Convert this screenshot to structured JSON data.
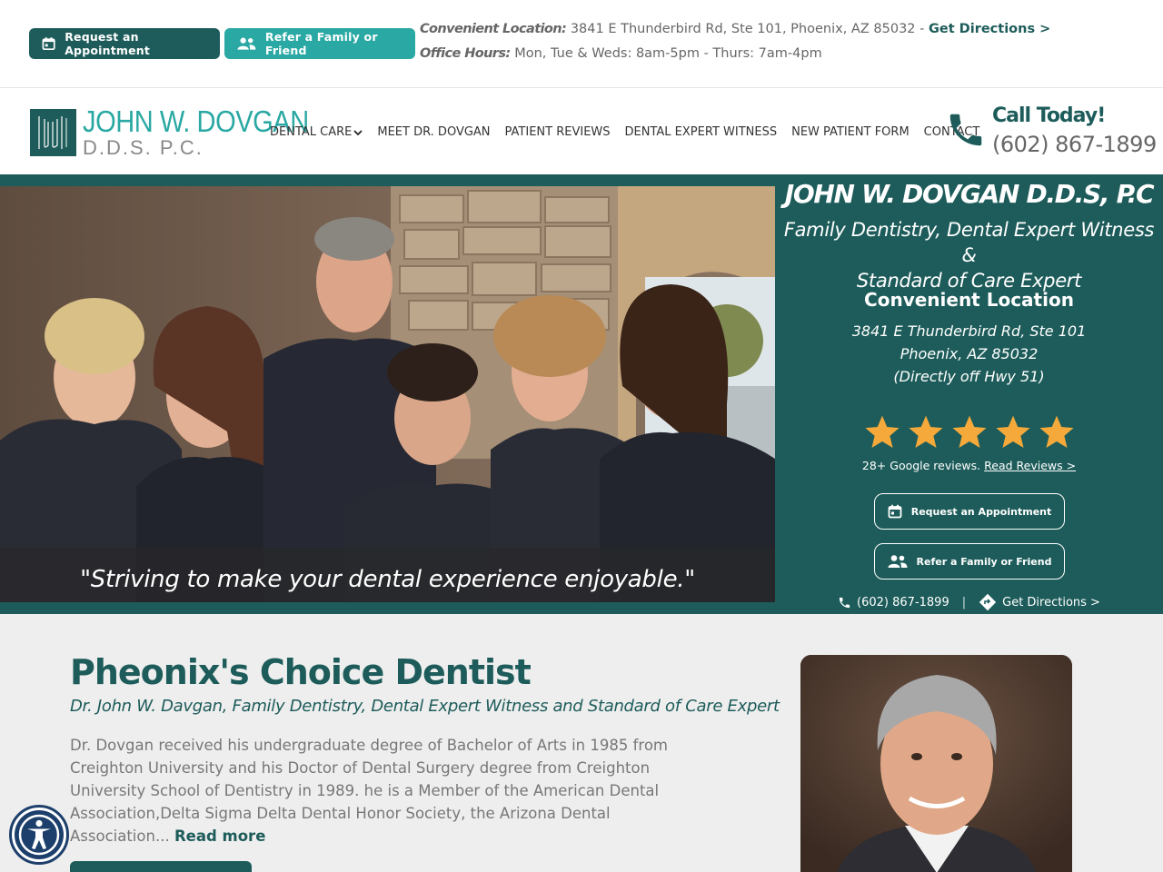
{
  "topbar": {
    "appointment_label": "Request an Appointment",
    "refer_label": "Refer a Family or Friend",
    "location_label": "Convenient Location:",
    "location_value": " 3841 E Thunderbird Rd, Ste 101, Phoenix, AZ 85032 - ",
    "directions_label": "Get Directions >",
    "hours_label": "Office Hours:",
    "hours_value": " Mon, Tue & Weds: 8am-5pm - Thurs: 7am-4pm"
  },
  "header": {
    "logo_name": "JOHN W. DOVGAN",
    "logo_sub": "D.D.S. P.C.",
    "nav": [
      "DENTAL CARE",
      "MEET DR. DOVGAN",
      "PATIENT REVIEWS",
      "DENTAL EXPERT WITNESS",
      "NEW PATIENT FORM",
      "CONTACT"
    ],
    "call_title": "Call Today!",
    "call_number": "(602) 867-1899"
  },
  "hero": {
    "quote": "\"Striving to make your dental experience enjoyable.\"",
    "panel": {
      "name": "JOHN W. DOVGAN D.D.S, P.C",
      "tagline_1": "Family Dentistry, Dental Expert Witness &",
      "tagline_2": "Standard of Care Expert",
      "location_title": "Convenient Location",
      "address_1": "3841 E Thunderbird Rd, Ste 101",
      "address_2": "Phoenix, AZ 85032",
      "address_3": "(Directly off Hwy 51)",
      "rating": 5,
      "reviews_text": "28+ Google reviews. ",
      "reviews_link": "Read Reviews >",
      "appointment_label": "Request an Appointment",
      "refer_label": "Refer a Family or Friend",
      "phone": "(602) 867-1899",
      "directions": "Get Directions >"
    }
  },
  "content": {
    "title": "Pheonix's Choice Dentist",
    "subtitle": "Dr. John W. Davgan, Family Dentistry, Dental Expert Witness and Standard of Care Expert",
    "body": "Dr. Dovgan received his undergraduate degree of Bachelor of Arts in 1985 from Creighton University and his Doctor of Dental Surgery degree from Creighton University School of Dentistry in 1989. he is a Member of the American Dental Association,Delta Sigma Delta Dental Honor Society, the Arizona Dental Association... ",
    "read_more": "Read more"
  },
  "colors": {
    "brand_dark": "#1d5c5a",
    "brand_light": "#2aa8a3",
    "star": "#f4a93a"
  }
}
